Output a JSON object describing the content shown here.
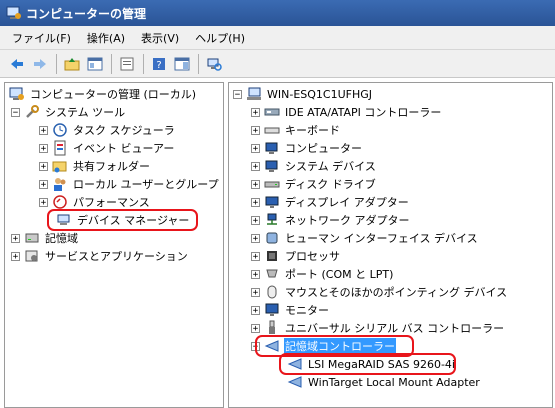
{
  "window": {
    "title": "コンピューターの管理"
  },
  "menu": [
    "ファイル(F)",
    "操作(A)",
    "表示(V)",
    "ヘルプ(H)"
  ],
  "left_tree": {
    "root": "コンピューターの管理 (ローカル)",
    "system_tools": "システム ツール",
    "task_scheduler": "タスク スケジューラ",
    "event_viewer": "イベント ビューアー",
    "shared_folders": "共有フォルダー",
    "local_users": "ローカル ユーザーとグループ",
    "performance": "パフォーマンス",
    "device_manager": "デバイス マネージャー",
    "storage": "記憶域",
    "services_apps": "サービスとアプリケーション"
  },
  "right_tree": {
    "host": "WIN-ESQ1C1UFHGJ",
    "items": [
      "IDE ATA/ATAPI コントローラー",
      "キーボード",
      "コンピューター",
      "システム デバイス",
      "ディスク ドライブ",
      "ディスプレイ アダプター",
      "ネットワーク アダプター",
      "ヒューマン インターフェイス デバイス",
      "プロセッサ",
      "ポート (COM と LPT)",
      "マウスとそのほかのポインティング デバイス",
      "モニター",
      "ユニバーサル シリアル バス コントローラー"
    ],
    "storage_controllers": "記憶域コントローラー",
    "lsi": "LSI MegaRAID SAS 9260-4i",
    "wintarget": "WinTarget Local Mount Adapter"
  },
  "colors": {
    "highlight": "#e8151b",
    "title_bar": "#2f5da3",
    "selection": "#3399ff"
  }
}
